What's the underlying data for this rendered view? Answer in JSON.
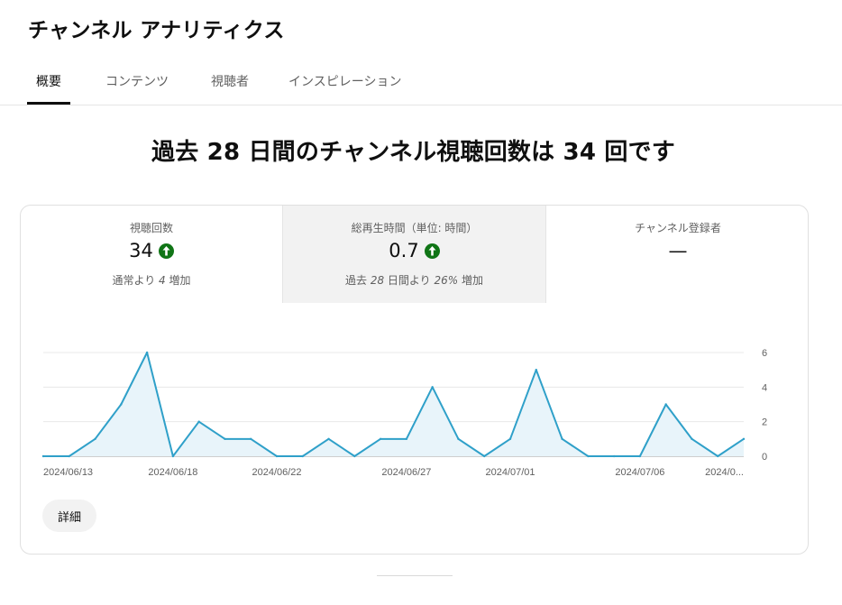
{
  "page": {
    "title": "チャンネル アナリティクス"
  },
  "tabs": [
    {
      "label": "概要",
      "active": true
    },
    {
      "label": "コンテンツ",
      "active": false
    },
    {
      "label": "視聴者",
      "active": false
    },
    {
      "label": "インスピレーション",
      "active": false
    }
  ],
  "headline": "過去 28 日間のチャンネル視聴回数は 34 回です",
  "metrics": [
    {
      "label": "視聴回数",
      "value": "34",
      "trend_icon": "arrow-up-icon",
      "sub_prefix": "通常より ",
      "sub_num": "4",
      "sub_suffix": " 増加"
    },
    {
      "label": "総再生時間（単位: 時間）",
      "value": "0.7",
      "trend_icon": "arrow-up-icon",
      "sub_prefix": "過去 ",
      "sub_num": "28",
      "sub_mid": " 日間より ",
      "sub_pct": "26%",
      "sub_suffix": " 増加"
    },
    {
      "label": "チャンネル登録者",
      "value": "—"
    }
  ],
  "colors": {
    "line": "#2fa0c9",
    "area": "#e8f4fa",
    "up": "#107516"
  },
  "chart_data": {
    "type": "area",
    "x_ticks": [
      "2024/06/13",
      "2024/06/18",
      "2024/06/22",
      "2024/06/27",
      "2024/07/01",
      "2024/07/06",
      "2024/0..."
    ],
    "values": [
      0,
      0,
      1,
      3,
      6,
      0,
      2,
      1,
      1,
      0,
      0,
      1,
      0,
      1,
      1,
      4,
      1,
      0,
      1,
      5,
      1,
      0,
      0,
      0,
      3,
      1,
      0,
      1
    ],
    "y_ticks": [
      "0",
      "2",
      "4",
      "6"
    ],
    "ylim": [
      0,
      6
    ],
    "grid": true
  },
  "detail_button": {
    "label": "詳細"
  }
}
